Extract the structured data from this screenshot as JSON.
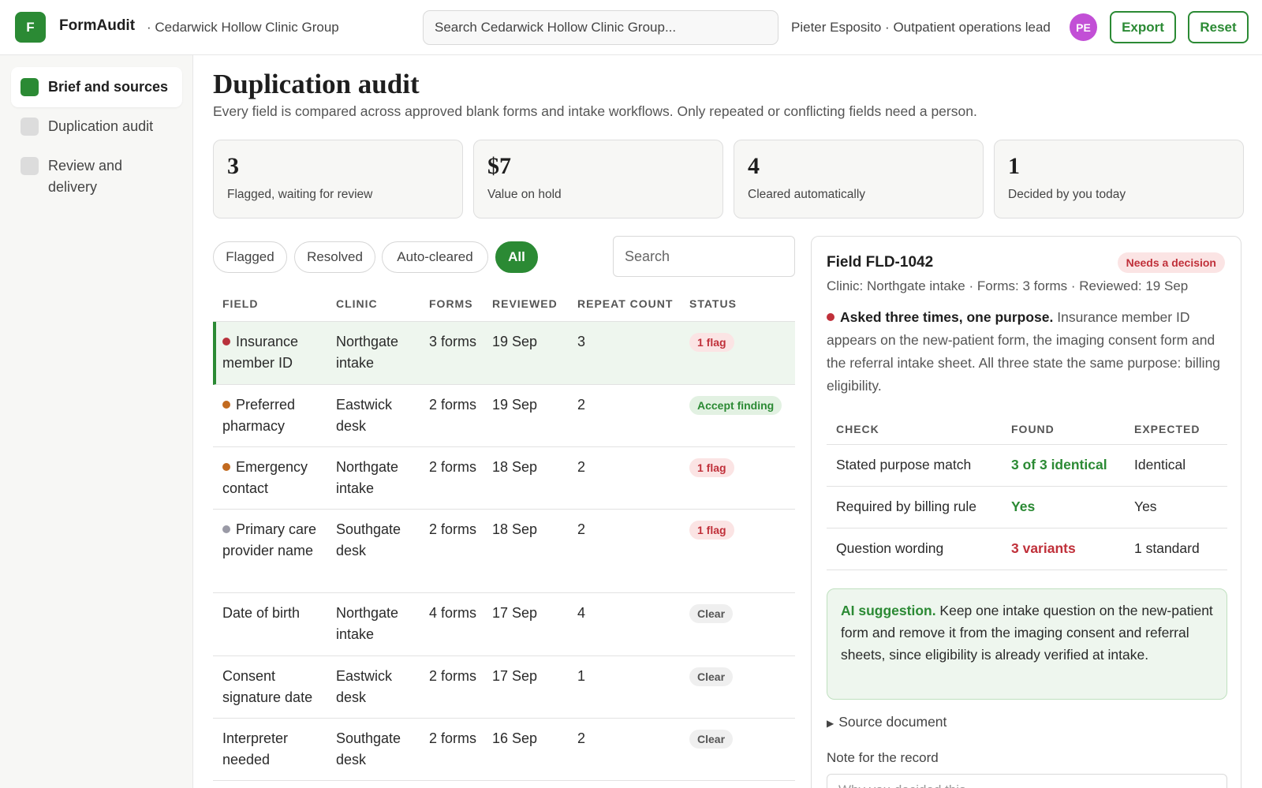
{
  "app": {
    "logo_letter": "F",
    "name": "FormAudit",
    "org": "· Cedarwick Hollow Clinic Group",
    "search_placeholder": "Search Cedarwick Hollow Clinic Group...",
    "user": "Pieter Esposito · Outpatient operations lead",
    "avatar_initials": "PE",
    "export_label": "Export",
    "reset_label": "Reset"
  },
  "sidebar": {
    "items": [
      {
        "label": "Brief and sources",
        "active": true
      },
      {
        "label": "Duplication audit",
        "active": false
      },
      {
        "label": "Review and delivery",
        "active": false
      }
    ]
  },
  "page": {
    "title": "Duplication audit",
    "subtitle": "Every field is compared across approved blank forms and intake workflows. Only repeated or conflicting fields need a person."
  },
  "stats": [
    {
      "value": "3",
      "label": "Flagged, waiting for review"
    },
    {
      "value": "$7",
      "label": "Value on hold"
    },
    {
      "value": "4",
      "label": "Cleared automatically"
    },
    {
      "value": "1",
      "label": "Decided by you today"
    }
  ],
  "filters": [
    "Flagged",
    "Resolved",
    "Auto-cleared",
    "All"
  ],
  "active_filter": "All",
  "list_search_placeholder": "Search",
  "table": {
    "headers": [
      "FIELD",
      "CLINIC",
      "FORMS",
      "REVIEWED",
      "REPEAT COUNT",
      "STATUS"
    ],
    "rows": [
      {
        "field": "Insurance member ID",
        "clinic": "Northgate intake",
        "forms": "3 forms",
        "reviewed": "19 Sep",
        "repeat": "3",
        "status": "1 flag",
        "status_type": "flag",
        "dot": "#b8323c"
      },
      {
        "field": "Preferred pharmacy",
        "clinic": "Eastwick desk",
        "forms": "2 forms",
        "reviewed": "19 Sep",
        "repeat": "2",
        "status": "Accept finding",
        "status_type": "accept",
        "dot": "#c26a1f"
      },
      {
        "field": "Emergency contact",
        "clinic": "Northgate intake",
        "forms": "2 forms",
        "reviewed": "18 Sep",
        "repeat": "2",
        "status": "1 flag",
        "status_type": "flag",
        "dot": "#c26a1f"
      },
      {
        "field": "Primary care provider name",
        "clinic": "Southgate desk",
        "forms": "2 forms",
        "reviewed": "18 Sep",
        "repeat": "2",
        "status": "1 flag",
        "status_type": "flag",
        "dot": "#9a9aa6"
      },
      {
        "field": "Date of birth",
        "clinic": "Northgate intake",
        "forms": "4 forms",
        "reviewed": "17 Sep",
        "repeat": "4",
        "status": "Clear",
        "status_type": "clear",
        "dot": ""
      },
      {
        "field": "Consent signature date",
        "clinic": "Eastwick desk",
        "forms": "2 forms",
        "reviewed": "17 Sep",
        "repeat": "1",
        "status": "Clear",
        "status_type": "clear",
        "dot": ""
      },
      {
        "field": "Interpreter needed",
        "clinic": "Southgate desk",
        "forms": "2 forms",
        "reviewed": "16 Sep",
        "repeat": "2",
        "status": "Clear",
        "status_type": "clear",
        "dot": ""
      }
    ]
  },
  "detail": {
    "title": "Field FLD-1042",
    "badge": "Needs a decision",
    "meta": "Clinic: Northgate intake · Forms: 3 forms · Reviewed: 19 Sep",
    "finding_bold": "Asked three times, one purpose.",
    "finding_text": " Insurance member ID appears on the new-patient form, the imaging consent form and the referral intake sheet. All three state the same purpose: billing eligibility.",
    "check_headers": [
      "CHECK",
      "FOUND",
      "EXPECTED"
    ],
    "checks": [
      {
        "check": "Stated purpose match",
        "found": "3 of 3 identical",
        "found_type": "good",
        "expected": "Identical"
      },
      {
        "check": "Required by billing rule",
        "found": "Yes",
        "found_type": "good",
        "expected": "Yes"
      },
      {
        "check": "Question wording",
        "found": "3 variants",
        "found_type": "bad",
        "expected": "1 standard"
      }
    ],
    "ai_label": "AI suggestion.",
    "ai_text": " Keep one intake question on the new-patient form and remove it from the imaging consent and referral sheets, since eligibility is already verified at intake.",
    "source_label": "Source document",
    "note_label": "Note for the record",
    "note_placeholder": "Why you decided this..."
  },
  "colors": {
    "accent": "#2b8a34",
    "danger": "#c0303a",
    "avatar": "#c24fd6"
  }
}
